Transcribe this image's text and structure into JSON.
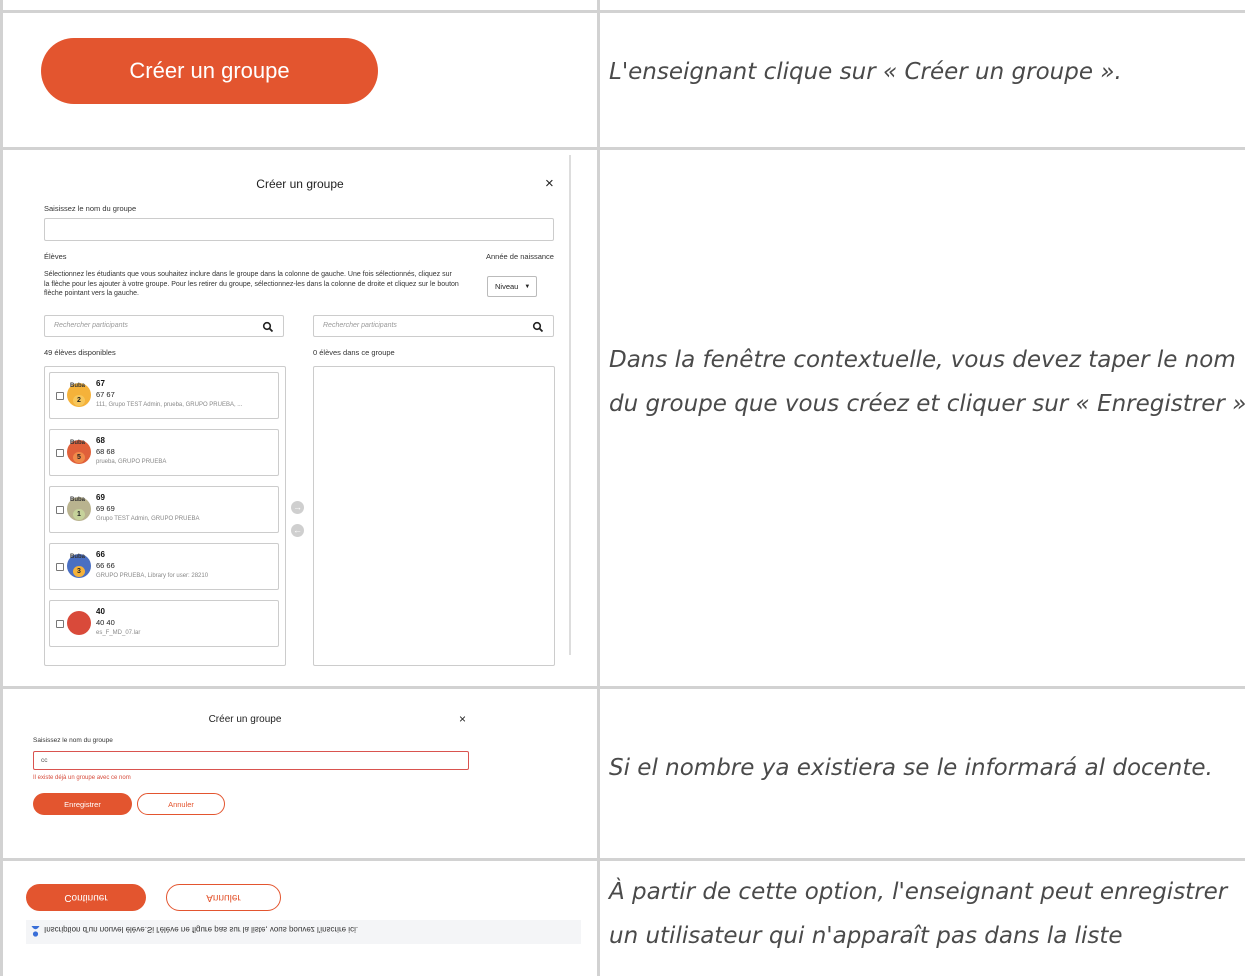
{
  "rows": [
    {
      "caption_lines": [
        "L'enseignant clique sur « Créer un groupe »."
      ],
      "button_label": "Créer un groupe"
    },
    {
      "caption_lines": [
        "Dans la fenêtre contextuelle, vous devez taper le nom",
        "du groupe que vous créez et cliquer sur « Enregistrer »"
      ],
      "modal": {
        "title": "Créer un groupe",
        "close": "×",
        "name_label": "Saisissez le nom du groupe",
        "students_label": "Élèves",
        "birth_year_label": "Année de naissance",
        "description": "Sélectionnez les étudiants que vous souhaitez inclure dans le groupe dans la colonne de gauche. Une fois sélectionnés, cliquez sur la flèche pour les ajouter à votre groupe. Pour les retirer du groupe, sélectionnez-les dans la colonne de droite et cliquez sur le bouton flèche pointant vers la gauche.",
        "level_select": "Niveau",
        "search_left_placeholder": "Rechercher participants",
        "search_right_placeholder": "Rechercher participants",
        "available_count": "49 élèves disponibles",
        "group_count": "0 élèves dans ce groupe",
        "students": [
          {
            "number": "67",
            "fullname": "67 67",
            "groups": "111, Grupo TEST Admin, prueba, GRUPO PRUEBA, ...",
            "badge": "2",
            "cap": "Buba",
            "color": "#f5b23a"
          },
          {
            "number": "68",
            "fullname": "68 68",
            "groups": "prueba, GRUPO PRUEBA",
            "badge": "5",
            "cap": "Buba",
            "color": "#e0603a"
          },
          {
            "number": "69",
            "fullname": "69 69",
            "groups": "Grupo TEST Admin, GRUPO PRUEBA",
            "badge": "1",
            "cap": "Buba",
            "color": "#b9b38f"
          },
          {
            "number": "66",
            "fullname": "66 66",
            "groups": "GRUPO PRUEBA, Library for user: 28210",
            "badge": "3",
            "cap": "Buba",
            "color": "#4a6fc2"
          },
          {
            "number": "40",
            "fullname": "40 40",
            "groups": "es_F_MD_07.lar",
            "badge": "",
            "cap": "",
            "color": "#d94a3a"
          }
        ]
      }
    },
    {
      "caption_lines": [
        "Si el nombre ya existiera se le informará al docente."
      ],
      "modal": {
        "title": "Créer un groupe",
        "close": "×",
        "name_label": "Saisissez le nom du groupe",
        "input_value": "cc",
        "error": "Il existe déjà un groupe avec ce nom",
        "save_label": "Enregistrer",
        "cancel_label": "Annuler"
      }
    },
    {
      "caption_lines": [
        "À partir de cette option, l'enseignant peut enregistrer",
        "un utilisateur qui n'apparaît pas dans la liste"
      ],
      "continue_label": "Continuer",
      "cancel_label": "Annuler",
      "register_text": "Inscription d'un nouvel élève.Si l'élève ne figure pas sur la liste, vous pouvez l'inscrire ici."
    }
  ],
  "colors": {
    "accent": "#e3552f",
    "border": "#d2d2d2",
    "caption": "#4a4a4a",
    "error": "#d64b3b"
  }
}
